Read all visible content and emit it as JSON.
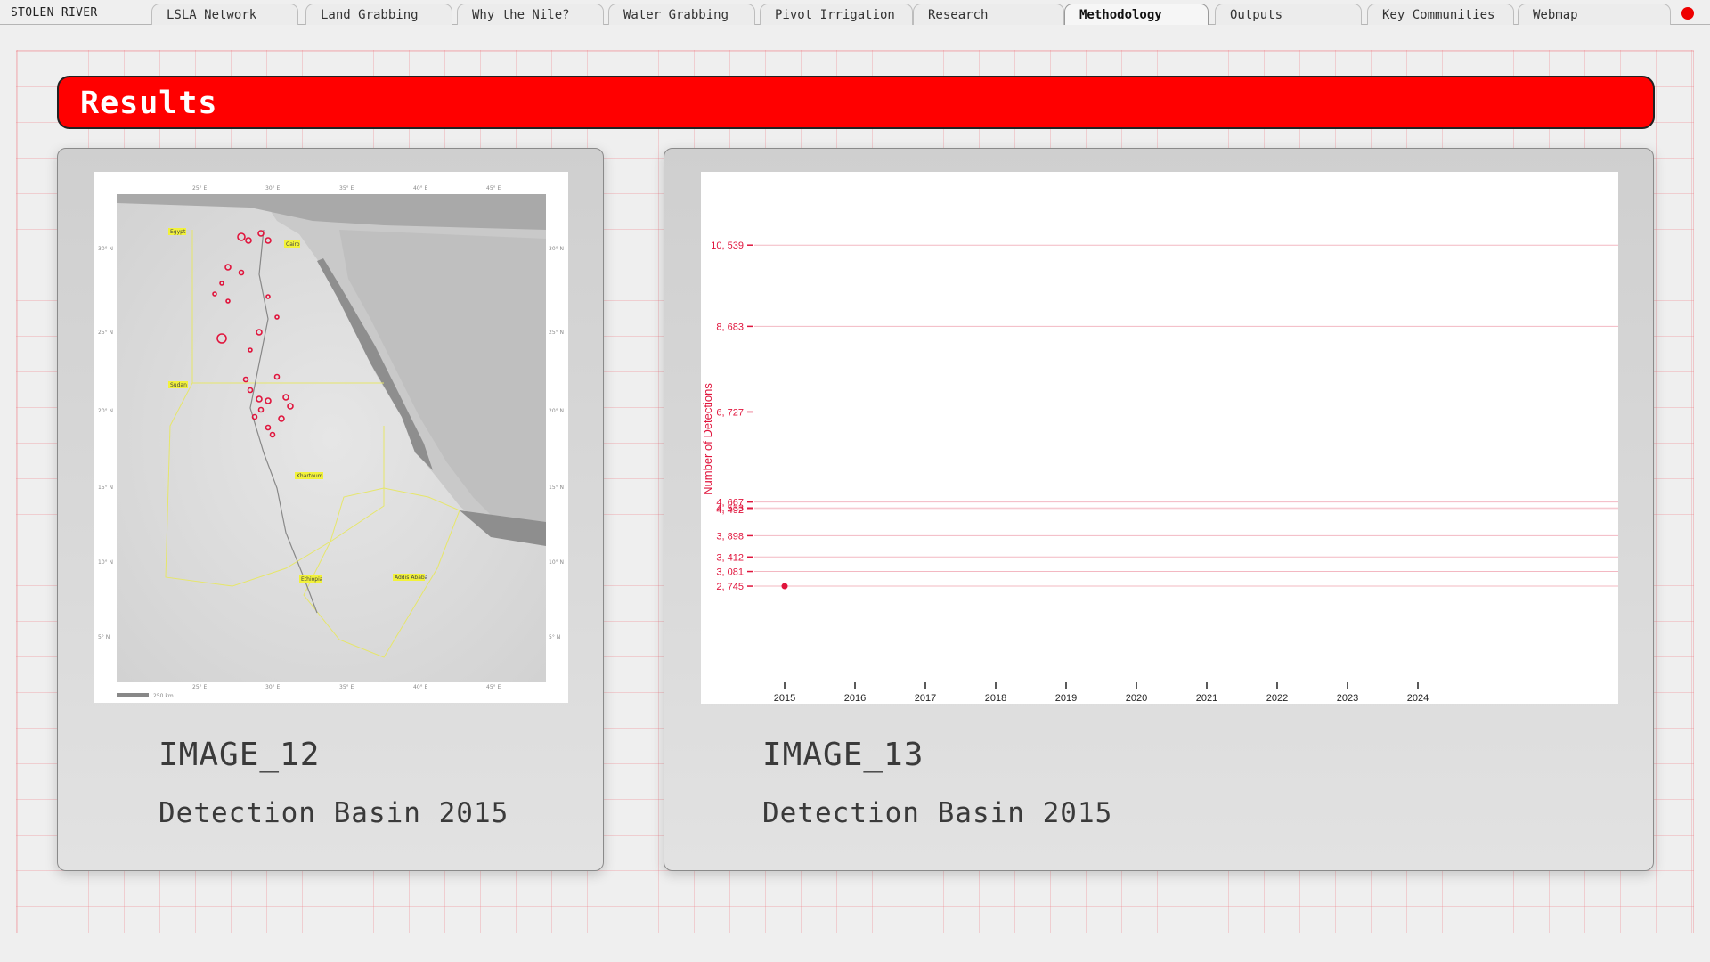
{
  "app": {
    "brand": "STOLEN RIVER"
  },
  "tabs": [
    {
      "label": "LSLA Network",
      "active": false
    },
    {
      "label": "Land Grabbing",
      "active": false
    },
    {
      "label": "Why the Nile?",
      "active": false
    },
    {
      "label": "Water Grabbing",
      "active": false
    },
    {
      "label": "Pivot Irrigation",
      "active": false
    },
    {
      "label": "Research",
      "active": false
    },
    {
      "label": "Methodology",
      "active": true
    },
    {
      "label": "Outputs",
      "active": false
    },
    {
      "label": "Key Communities",
      "active": false
    },
    {
      "label": "Webmap",
      "active": false
    }
  ],
  "banner": {
    "title": "Results",
    "color": "#ff0000"
  },
  "cards": [
    {
      "title": "IMAGE_12",
      "subtitle": "Detection Basin 2015",
      "map": {
        "lon_labels": [
          "25° E",
          "30° E",
          "35° E",
          "40° E",
          "45° E"
        ],
        "lat_labels": [
          "30° N",
          "25° N",
          "20° N",
          "15° N",
          "10° N",
          "5° N"
        ],
        "country_tags": [
          "Egypt",
          "Cairo",
          "Sudan",
          "Khartoum",
          "Ethiopia",
          "Addis Ababa"
        ],
        "scale_label": "250 km"
      }
    },
    {
      "title": "IMAGE_13",
      "subtitle": "Detection Basin 2015",
      "chart_data": {
        "type": "scatter",
        "ylabel": "Number of Detections",
        "xlabel": "",
        "x_ticks": [
          "2015",
          "2016",
          "2017",
          "2018",
          "2019",
          "2020",
          "2021",
          "2022",
          "2023",
          "2024"
        ],
        "y_ticks": [
          "2, 745",
          "3, 081",
          "3, 412",
          "3, 898",
          "4, 533",
          "4, 667",
          "4, 492",
          "6, 727",
          "8, 683",
          "10, 539"
        ],
        "y_tick_values": [
          2745,
          3081,
          3412,
          3898,
          4533,
          4667,
          4492,
          6727,
          8683,
          10539
        ],
        "points": [
          {
            "x": "2015",
            "y": 2745
          }
        ],
        "ylim": [
          2400,
          11500
        ],
        "grid": true,
        "accent": "#e0143c"
      }
    }
  ]
}
